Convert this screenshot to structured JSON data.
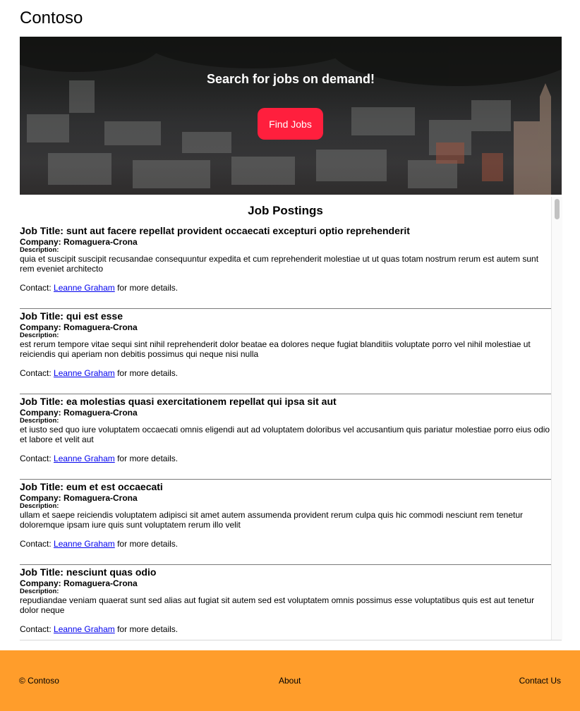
{
  "header": {
    "site_title": "Contoso"
  },
  "hero": {
    "heading": "Search for jobs on demand!",
    "button_label": "Find Jobs",
    "button_color": "#ff1f3d"
  },
  "postings": {
    "heading": "Job Postings",
    "company_prefix": "Company: ",
    "contact_prefix": "Contact: ",
    "contact_suffix": " for more details.",
    "jobs": [
      {
        "title": "Job Title: sunt aut facere repellat provident occaecati excepturi optio reprehenderit",
        "company": "Company: Romaguera-Crona",
        "description_label": "Description:",
        "description": "quia et suscipit suscipit recusandae consequuntur expedita et cum reprehenderit molestiae ut ut quas totam nostrum rerum est autem sunt rem eveniet architecto",
        "contact_name": "Leanne Graham"
      },
      {
        "title": "Job Title: qui est esse",
        "company": "Company: Romaguera-Crona",
        "description_label": "Description:",
        "description": "est rerum tempore vitae sequi sint nihil reprehenderit dolor beatae ea dolores neque fugiat blanditiis voluptate porro vel nihil molestiae ut reiciendis qui aperiam non debitis possimus qui neque nisi nulla",
        "contact_name": "Leanne Graham"
      },
      {
        "title": "Job Title: ea molestias quasi exercitationem repellat qui ipsa sit aut",
        "company": "Company: Romaguera-Crona",
        "description_label": "Description:",
        "description": "et iusto sed quo iure voluptatem occaecati omnis eligendi aut ad voluptatem doloribus vel accusantium quis pariatur molestiae porro eius odio et labore et velit aut",
        "contact_name": "Leanne Graham"
      },
      {
        "title": "Job Title: eum et est occaecati",
        "company": "Company: Romaguera-Crona",
        "description_label": "Description:",
        "description": "ullam et saepe reiciendis voluptatem adipisci sit amet autem assumenda provident rerum culpa quis hic commodi nesciunt rem tenetur doloremque ipsam iure quis sunt voluptatem rerum illo velit",
        "contact_name": "Leanne Graham"
      },
      {
        "title": "Job Title: nesciunt quas odio",
        "company": "Company: Romaguera-Crona",
        "description_label": "Description:",
        "description": "repudiandae veniam quaerat sunt sed alias aut fugiat sit autem sed est voluptatem omnis possimus esse voluptatibus quis est aut tenetur dolor neque",
        "contact_name": "Leanne Graham"
      }
    ]
  },
  "footer": {
    "copyright": "© Contoso",
    "about": "About",
    "contact_us": "Contact Us",
    "background_color": "#ff9d2b"
  }
}
